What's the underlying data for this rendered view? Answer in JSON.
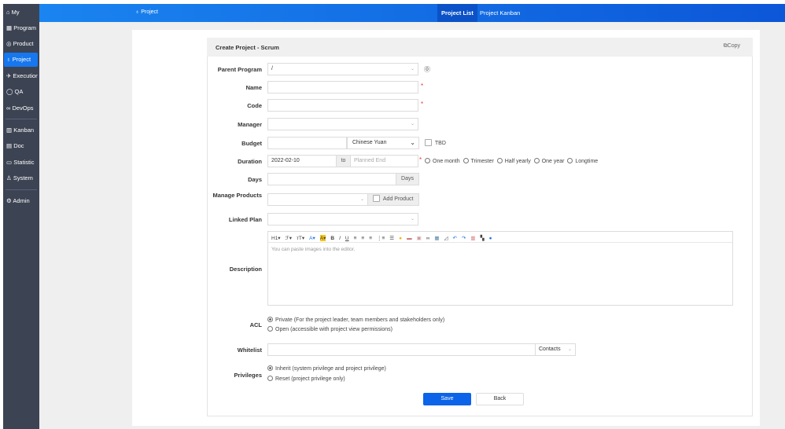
{
  "sidebar": {
    "items": [
      {
        "label": "My",
        "icon": "home-icon",
        "glyph": "⌂"
      },
      {
        "label": "Program",
        "icon": "grid-icon",
        "glyph": "▦"
      },
      {
        "label": "Product",
        "icon": "bulb-icon",
        "glyph": "◎"
      },
      {
        "label": "Project",
        "icon": "project-icon",
        "glyph": "♁"
      },
      {
        "label": "Execution",
        "icon": "run-icon",
        "glyph": "✈"
      },
      {
        "label": "QA",
        "icon": "qa-icon",
        "glyph": "◯"
      },
      {
        "label": "DevOps",
        "icon": "infinity-icon",
        "glyph": "∞"
      },
      {
        "label": "Kanban",
        "icon": "kanban-icon",
        "glyph": "▥"
      },
      {
        "label": "Doc",
        "icon": "doc-icon",
        "glyph": "▤"
      },
      {
        "label": "Statistic",
        "icon": "chart-icon",
        "glyph": "▭"
      },
      {
        "label": "System",
        "icon": "user-icon",
        "glyph": "♙"
      },
      {
        "label": "Admin",
        "icon": "gear-icon",
        "glyph": "⚙"
      }
    ],
    "active": "Project"
  },
  "header": {
    "module": "♁ Project",
    "tabs": [
      "Project List",
      "Project Kanban"
    ]
  },
  "form": {
    "title": "Create Project - Scrum",
    "copy": "Copy",
    "parent_program": {
      "label": "Parent Program",
      "value": "/"
    },
    "name": {
      "label": "Name"
    },
    "code": {
      "label": "Code"
    },
    "manager": {
      "label": "Manager"
    },
    "budget": {
      "label": "Budget",
      "currency": "Chinese Yuan",
      "tbd": "TBD"
    },
    "duration": {
      "label": "Duration",
      "begin": "2022-02-10",
      "to": "to",
      "end_placeholder": "Planned End",
      "options": [
        "One month",
        "Trimester",
        "Half yearly",
        "One year",
        "Longtime"
      ]
    },
    "days": {
      "label": "Days",
      "unit": "Days"
    },
    "products": {
      "label": "Manage Products",
      "add": "Add Product"
    },
    "plan": {
      "label": "Linked Plan"
    },
    "description": {
      "label": "Description",
      "placeholder": "You can paste images into the editor.",
      "toolbar": [
        "H1▾",
        "ℱ▾",
        "ᴛT▾",
        "A▾",
        "A▾",
        "B",
        "I",
        "U",
        "≡",
        "≡",
        "≡",
        "⋮≡",
        "☰",
        "●",
        "▬",
        "▣",
        "∞",
        "▦",
        "◿",
        "↶",
        "↷",
        "▥",
        "▚",
        "●"
      ]
    },
    "acl": {
      "label": "ACL",
      "options": [
        "Private (For the project leader, team members and stakeholders only)",
        "Open (accessible with project view permissions)"
      ]
    },
    "whitelist": {
      "label": "Whitelist",
      "contacts": "Contacts"
    },
    "privileges": {
      "label": "Privileges",
      "options": [
        "Inherit (system privilege and project privilege)",
        "Reset (project privilege only)"
      ]
    },
    "save": "Save",
    "back": "Back"
  }
}
